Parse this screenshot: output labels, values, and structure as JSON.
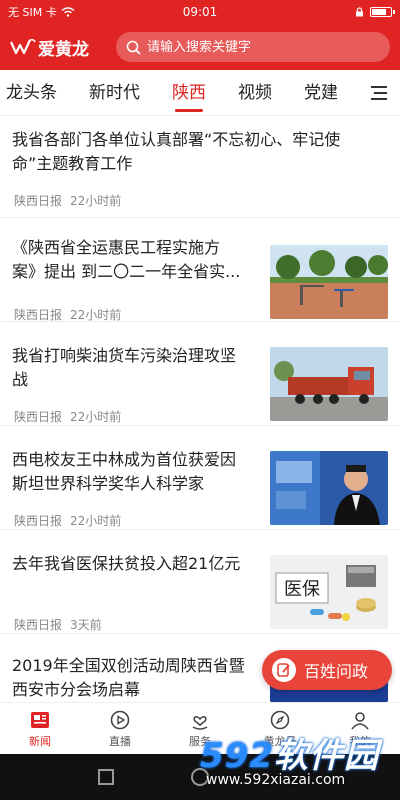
{
  "status_bar": {
    "carrier": "无 SIM 卡",
    "time": "09:01",
    "battery_level": 0.8
  },
  "header": {
    "logo_text": "爱黄龙",
    "search_placeholder": "请输入搜索关键字"
  },
  "tabs": [
    {
      "label": "龙头条",
      "active": false
    },
    {
      "label": "新时代",
      "active": false
    },
    {
      "label": "陕西",
      "active": true
    },
    {
      "label": "视频",
      "active": false
    },
    {
      "label": "党建",
      "active": false
    }
  ],
  "feed": [
    {
      "title_lines": [
        "我省各部门各单位认真部署“不忘初心、牢记使",
        "命”主题教育工作"
      ],
      "source": "陕西日报",
      "time": "22小时前",
      "thumb": "none"
    },
    {
      "title_lines": [
        "《陕西省全运惠民工程实施方",
        "案》提出 到二〇二一年全省实..."
      ],
      "source": "陕西日报",
      "time": "22小时前",
      "thumb": "park"
    },
    {
      "title_lines": [
        "我省打响柴油货车污染治理攻坚",
        "战"
      ],
      "source": "陕西日报",
      "time": "22小时前",
      "thumb": "truck"
    },
    {
      "title_lines": [
        "西电校友王中林成为首位获爱因",
        "斯坦世界科学奖华人科学家"
      ],
      "source": "陕西日报",
      "time": "22小时前",
      "thumb": "person"
    },
    {
      "title_lines": [
        "去年我省医保扶贫投入超21亿元"
      ],
      "source": "陕西日报",
      "time": "3天前",
      "thumb": "medical",
      "thumb_text": "医保"
    },
    {
      "title_lines": [
        "2019年全国双创活动周陕西省暨",
        "西安市分会场启幕"
      ],
      "source": "",
      "time": "",
      "thumb": "event"
    }
  ],
  "fab": {
    "label": "百姓问政"
  },
  "bottom_nav": [
    {
      "label": "新闻",
      "icon": "news-icon",
      "active": true
    },
    {
      "label": "直播",
      "icon": "play-icon",
      "active": false
    },
    {
      "label": "服务",
      "icon": "heart-hand-icon",
      "active": false
    },
    {
      "label": "黄龙号",
      "icon": "compass-icon",
      "active": false
    },
    {
      "label": "我的",
      "icon": "user-icon",
      "active": false
    }
  ],
  "watermark": {
    "brand_num": "592",
    "brand_text": "软件园",
    "url": "www.592xiazai.com"
  },
  "colors": {
    "brand_red": "#e02424",
    "text": "#222222",
    "meta": "#888888"
  }
}
